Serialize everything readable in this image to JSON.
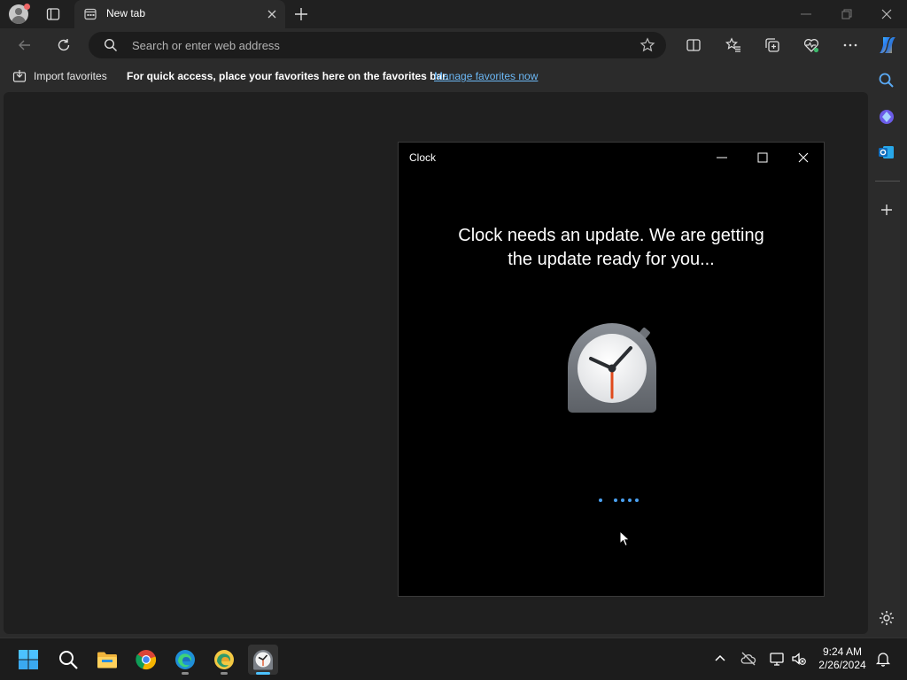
{
  "browser": {
    "tab": {
      "title": "New tab"
    },
    "address_bar": {
      "placeholder": "Search or enter web address"
    },
    "favorites_bar": {
      "import_label": "Import favorites",
      "tip": "For quick access, place your favorites here on the favorites bar.",
      "manage_link": "Manage favorites now"
    }
  },
  "clock_window": {
    "title": "Clock",
    "message_line1": "Clock needs an update. We are getting",
    "message_line2": "the update ready for you..."
  },
  "taskbar": {
    "apps": [
      "start-icon",
      "search-icon",
      "file-explorer-icon",
      "chrome-icon",
      "edge-icon",
      "edge-canary-icon",
      "clock-app-icon"
    ],
    "time": "9:24 AM",
    "date": "2/26/2024"
  },
  "colors": {
    "accent_link": "#6cb8f5",
    "taskbar_active": "#4cc2ff",
    "loading_dots": "#4aa0f0"
  }
}
